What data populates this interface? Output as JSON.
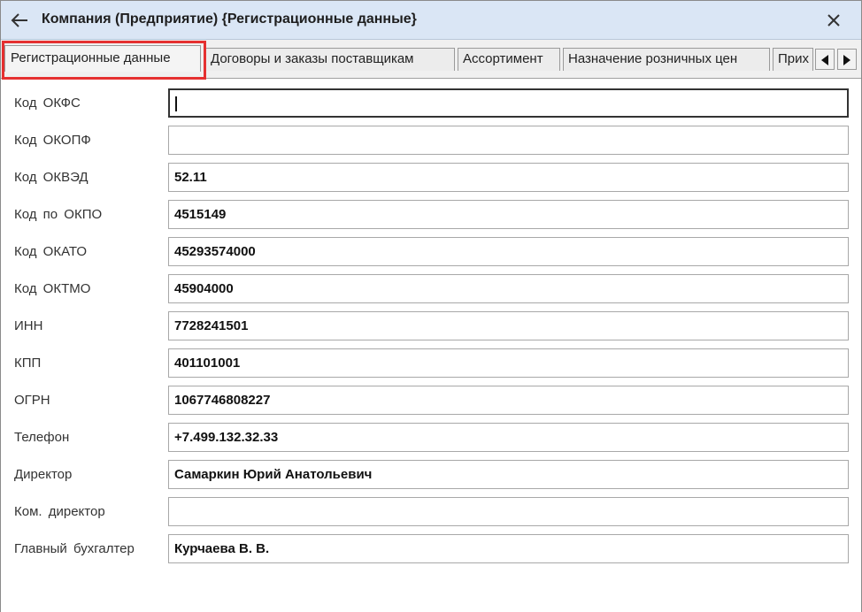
{
  "window": {
    "title": "Компания (Предприятие) {Регистрационные данные}",
    "back_icon": "arrow-left-icon",
    "close_icon": "close-icon"
  },
  "tabs": [
    {
      "label": "Регистрационные данные",
      "active": true
    },
    {
      "label": "Договоры и заказы поставщикам",
      "active": false
    },
    {
      "label": "Ассортимент",
      "active": false
    },
    {
      "label": "Назначение розничных цен",
      "active": false
    },
    {
      "label": "Прих",
      "active": false
    }
  ],
  "tab_scroll": {
    "left_icon": "triangle-left-icon",
    "right_icon": "triangle-right-icon"
  },
  "fields": [
    {
      "label": "Код ОКФС",
      "value": ""
    },
    {
      "label": "Код ОКОПФ",
      "value": ""
    },
    {
      "label": "Код ОКВЭД",
      "value": "52.11"
    },
    {
      "label": "Код по ОКПО",
      "value": "4515149"
    },
    {
      "label": "Код ОКАТО",
      "value": "45293574000"
    },
    {
      "label": "Код ОКТМО",
      "value": "45904000"
    },
    {
      "label": "ИНН",
      "value": "7728241501"
    },
    {
      "label": "КПП",
      "value": "401101001"
    },
    {
      "label": "ОГРН",
      "value": "1067746808227"
    },
    {
      "label": "Телефон",
      "value": "+7.499.132.32.33"
    },
    {
      "label": "Директор",
      "value": "Самаркин Юрий Анатольевич"
    },
    {
      "label": "Ком. директор",
      "value": ""
    },
    {
      "label": "Главный бухгалтер",
      "value": "Курчаева В. В."
    }
  ],
  "colors": {
    "titlebar": "#dae6f5",
    "highlight": "#e53030"
  }
}
